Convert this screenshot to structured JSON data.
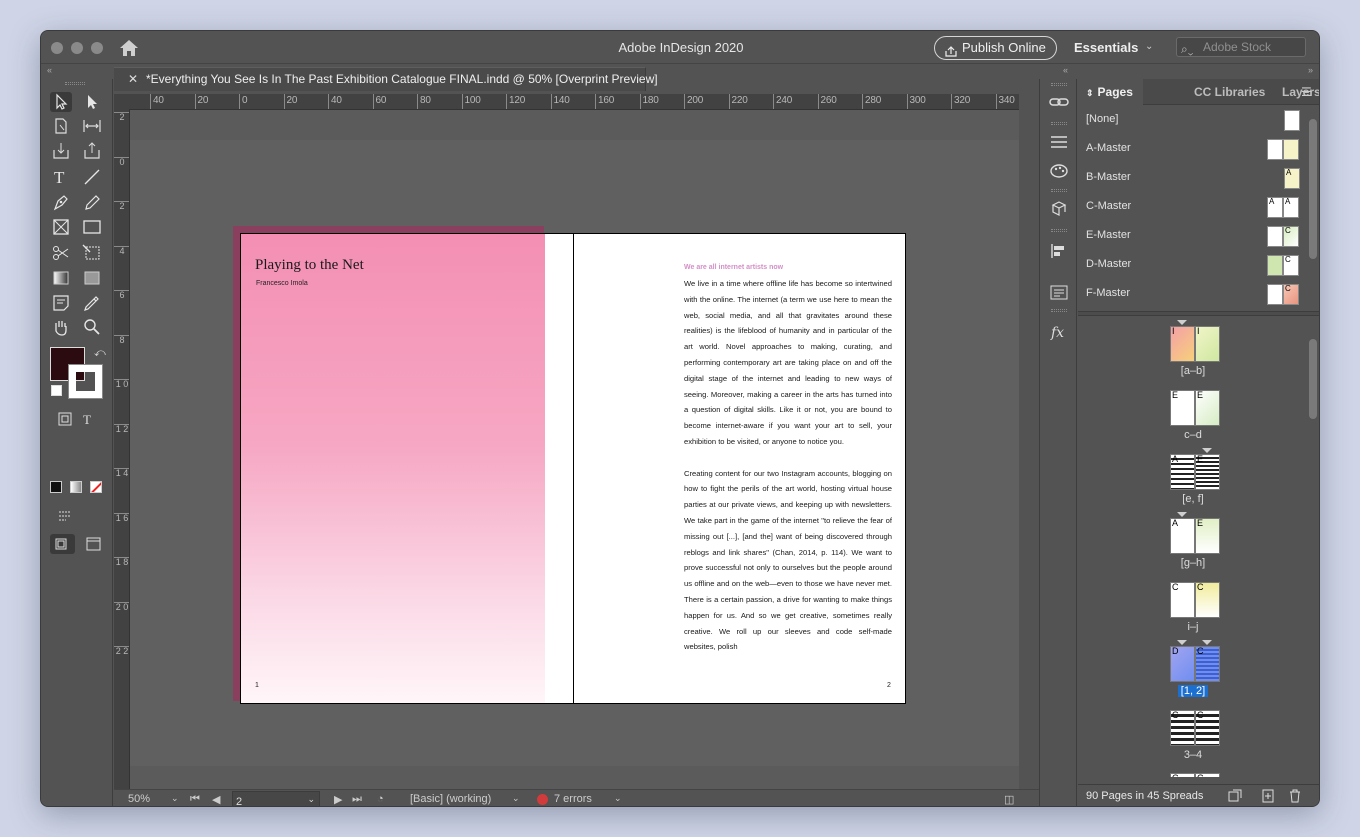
{
  "app": {
    "title": "Adobe InDesign 2020"
  },
  "header": {
    "publish_label": "Publish Online",
    "workspace_label": "Essentials",
    "stock_placeholder": "Adobe Stock"
  },
  "document": {
    "tab_title": "*Everything You See Is In The Past Exhibition Catalogue FINAL.indd @ 50% [Overprint Preview]"
  },
  "rulers": {
    "h_ticks": [
      "40",
      "20",
      "0",
      "20",
      "40",
      "60",
      "80",
      "100",
      "120",
      "140",
      "160",
      "180",
      "200",
      "220",
      "240",
      "260",
      "280",
      "300",
      "320",
      "340"
    ],
    "v_ticks": [
      "2",
      "0",
      "2",
      "4",
      "6",
      "8",
      "1 0",
      "1 2",
      "1 4",
      "1 6",
      "1 8",
      "2 0",
      "2 2"
    ]
  },
  "left_page": {
    "title": "Playing to the Net",
    "author": "Francesco Imola",
    "page_number": "1"
  },
  "right_page": {
    "heading": "We are all internet artists now",
    "paragraphs": [
      "We live in a time where offline life has become so intertwined with the online. The internet (a term we use here to mean the web, social media, and all that gravitates around these realities) is the lifeblood of humanity and in particular of the art world. Novel approaches to making, curating, and performing contemporary art are taking place on and off the digital stage of the internet and leading to new ways of seeing. Moreover, making a career in the arts has turned into a question of digital skills. Like it or not, you are bound to become internet-aware if you want your art to sell, your exhibition to be visited, or anyone to notice you.",
      "Creating content for our two Instagram accounts, blogging on how to fight the perils of the art world, hosting virtual house parties at our private views, and keeping up with newsletters. We take part in the game of the internet \"to relieve the fear of missing out [...], [and the] want of being discovered through reblogs and link shares\" (Chan, 2014, p. 114). We want to prove successful not only to ourselves but the people around us offline and on the web—even to those we have never met. There is a certain passion, a drive for wanting to make things happen for us. And so we get creative, sometimes really creative. We roll up our sleeves and code self-made websites, polish"
    ],
    "page_number": "2"
  },
  "status": {
    "zoom": "50%",
    "page": "2",
    "preflight_profile": "[Basic] (working)",
    "errors": "7 errors"
  },
  "panel": {
    "tabs": [
      "Pages",
      "CC Libraries",
      "Layers"
    ],
    "masters": [
      {
        "name": "[None]",
        "left": "",
        "right": ""
      },
      {
        "name": "A-Master",
        "left": "",
        "right": ""
      },
      {
        "name": "B-Master",
        "left": "",
        "right": "A"
      },
      {
        "name": "C-Master",
        "left": "A",
        "right": "A"
      },
      {
        "name": "E-Master",
        "left": "",
        "right": "C"
      },
      {
        "name": "D-Master",
        "left": "",
        "right": "C"
      },
      {
        "name": "F-Master",
        "left": "",
        "right": "C"
      }
    ],
    "spreads": [
      {
        "label": "[a–b]",
        "left_master": "I",
        "right_master": "I"
      },
      {
        "label": "c–d",
        "left_master": "E",
        "right_master": "E"
      },
      {
        "label": "[e, f]",
        "left_master": "A",
        "right_master": "E"
      },
      {
        "label": "[g–h]",
        "left_master": "A",
        "right_master": "E"
      },
      {
        "label": "i–j",
        "left_master": "C",
        "right_master": "C"
      },
      {
        "label": "[1, 2]",
        "left_master": "D",
        "right_master": "C"
      },
      {
        "label": "3–4",
        "left_master": "C",
        "right_master": "C"
      }
    ],
    "footer": "90 Pages in 45 Spreads"
  },
  "colors": {
    "accent_selection": "#1a6fd1",
    "pink_gradient_top": "#f48fb3",
    "heading_pink": "#d48fc7",
    "error_red": "#d13b3b"
  }
}
